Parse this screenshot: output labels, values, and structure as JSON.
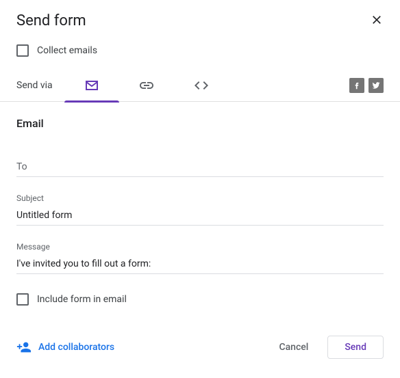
{
  "header": {
    "title": "Send form"
  },
  "collect": {
    "label": "Collect emails",
    "checked": false
  },
  "sendvia": {
    "label": "Send via"
  },
  "section": {
    "title": "Email"
  },
  "fields": {
    "to": {
      "placeholder": "To",
      "value": ""
    },
    "subject": {
      "label": "Subject",
      "value": "Untitled form"
    },
    "message": {
      "label": "Message",
      "value": "I've invited you to fill out a form:"
    }
  },
  "include": {
    "label": "Include form in email",
    "checked": false
  },
  "footer": {
    "add_collaborators": "Add collaborators",
    "cancel": "Cancel",
    "send": "Send"
  }
}
